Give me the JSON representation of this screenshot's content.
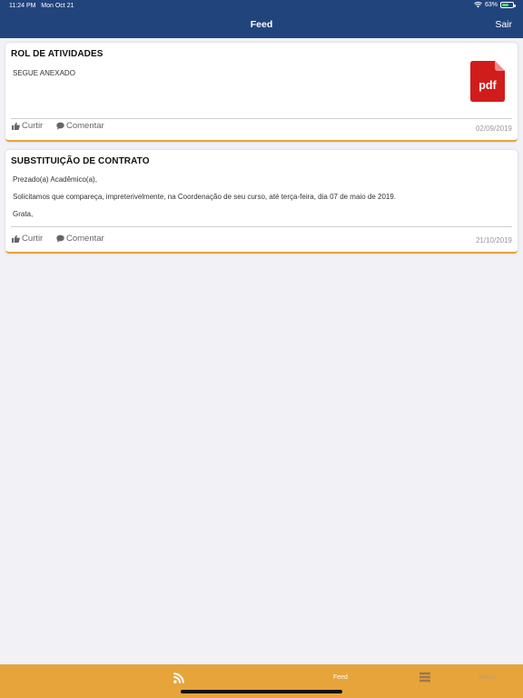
{
  "status_bar": {
    "time": "11:24 PM",
    "date": "Mon Oct 21",
    "battery": "63%",
    "battery_level": 0.63
  },
  "header": {
    "title": "Feed",
    "logout_label": "Sair",
    "background_color": "#22447d"
  },
  "feed": [
    {
      "title": "ROL DE ATIVIDADES",
      "body": [
        "SEGUE ANEXADO"
      ],
      "attachment_label": "pdf",
      "like_label": "Curtir",
      "comment_label": "Comentar",
      "date": "02/09/2019"
    },
    {
      "title": "SUBSTITUIÇÃO DE CONTRATO",
      "body": [
        "Prezado(a) Acadêmico(a),",
        "Solicitamos que compareça, impreterivelmente, na Coordenação de seu curso, até terça-feira, dia 07 de maio de 2019.",
        "Grata,"
      ],
      "like_label": "Curtir",
      "comment_label": "Comentar",
      "date": "21/10/2019"
    }
  ],
  "tab_bar": {
    "background_color": "#e6a43b",
    "tabs": [
      {
        "label": "Feed",
        "icon": "rss-icon",
        "active": true
      },
      {
        "label": "Menu",
        "icon": "menu-icon",
        "active": false
      }
    ]
  }
}
